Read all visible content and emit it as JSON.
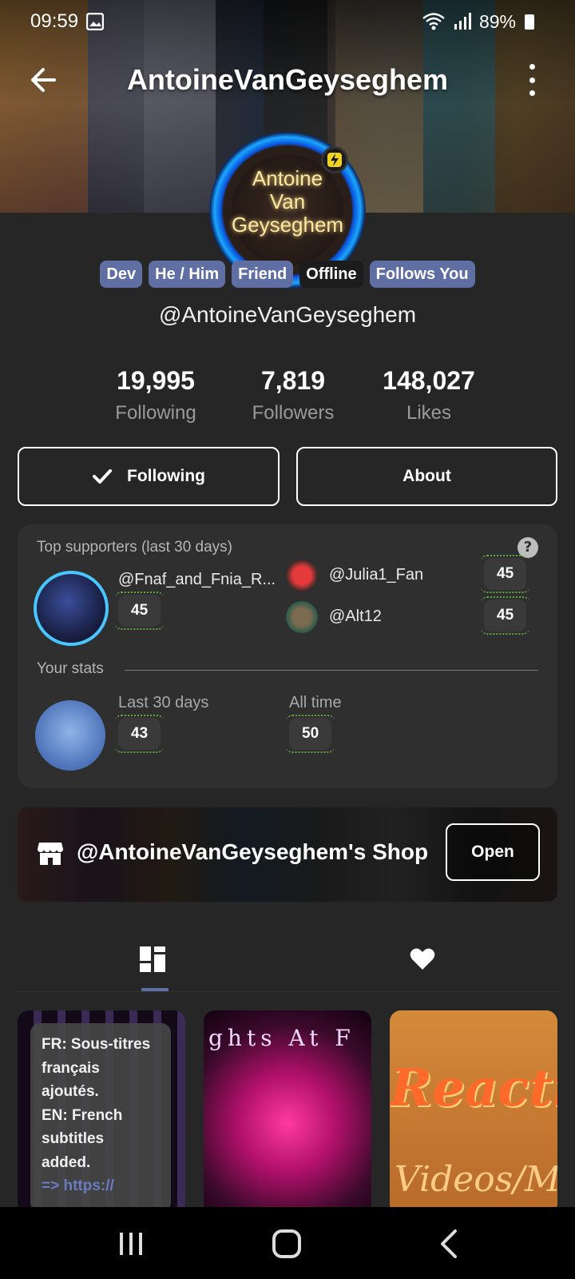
{
  "status": {
    "time": "09:59",
    "battery": "89%"
  },
  "header": {
    "title": "AntoineVanGeyseghem"
  },
  "avatar": {
    "line1": "Antoine",
    "line2": "Van",
    "line3": "Geyseghem"
  },
  "badges": [
    "Dev",
    "He / Him",
    "Friend",
    "Offline",
    "Follows You"
  ],
  "profile": {
    "handle": "@AntoineVanGeyseghem"
  },
  "stats": [
    {
      "value": "19,995",
      "label": "Following"
    },
    {
      "value": "7,819",
      "label": "Followers"
    },
    {
      "value": "148,027",
      "label": "Likes"
    }
  ],
  "actions": {
    "following_label": "Following",
    "about_label": "About"
  },
  "supporters": {
    "title": "Top supporters (last 30 days)",
    "top": {
      "name": "@Fnaf_and_Fnia_R...",
      "amount": "45"
    },
    "others": [
      {
        "name": "@Julia1_Fan",
        "amount": "45"
      },
      {
        "name": "@Alt12",
        "amount": "45"
      }
    ],
    "your_stats_label": "Your stats",
    "last30_label": "Last 30 days",
    "last30_value": "43",
    "alltime_label": "All time",
    "alltime_value": "50"
  },
  "shop": {
    "title": "@AntoineVanGeyseghem's Shop",
    "open_label": "Open"
  },
  "tabs": [
    {
      "icon": "grid-icon",
      "active": true
    },
    {
      "icon": "heart-icon",
      "active": false
    }
  ],
  "videos": {
    "tooltip_lines": [
      "FR: Sous-titres",
      "français",
      "ajoutés.",
      "EN: French",
      "subtitles",
      "added."
    ],
    "tooltip_link": "=> https://",
    "tile2_text": "ghts At F",
    "tile3_text": "Reacti",
    "tile3_sub": "Videos/M"
  },
  "colors": {
    "background": "#262626",
    "badge": "#5f6fa3",
    "card": "#2f2f2f",
    "accent": "#48c6ff"
  }
}
